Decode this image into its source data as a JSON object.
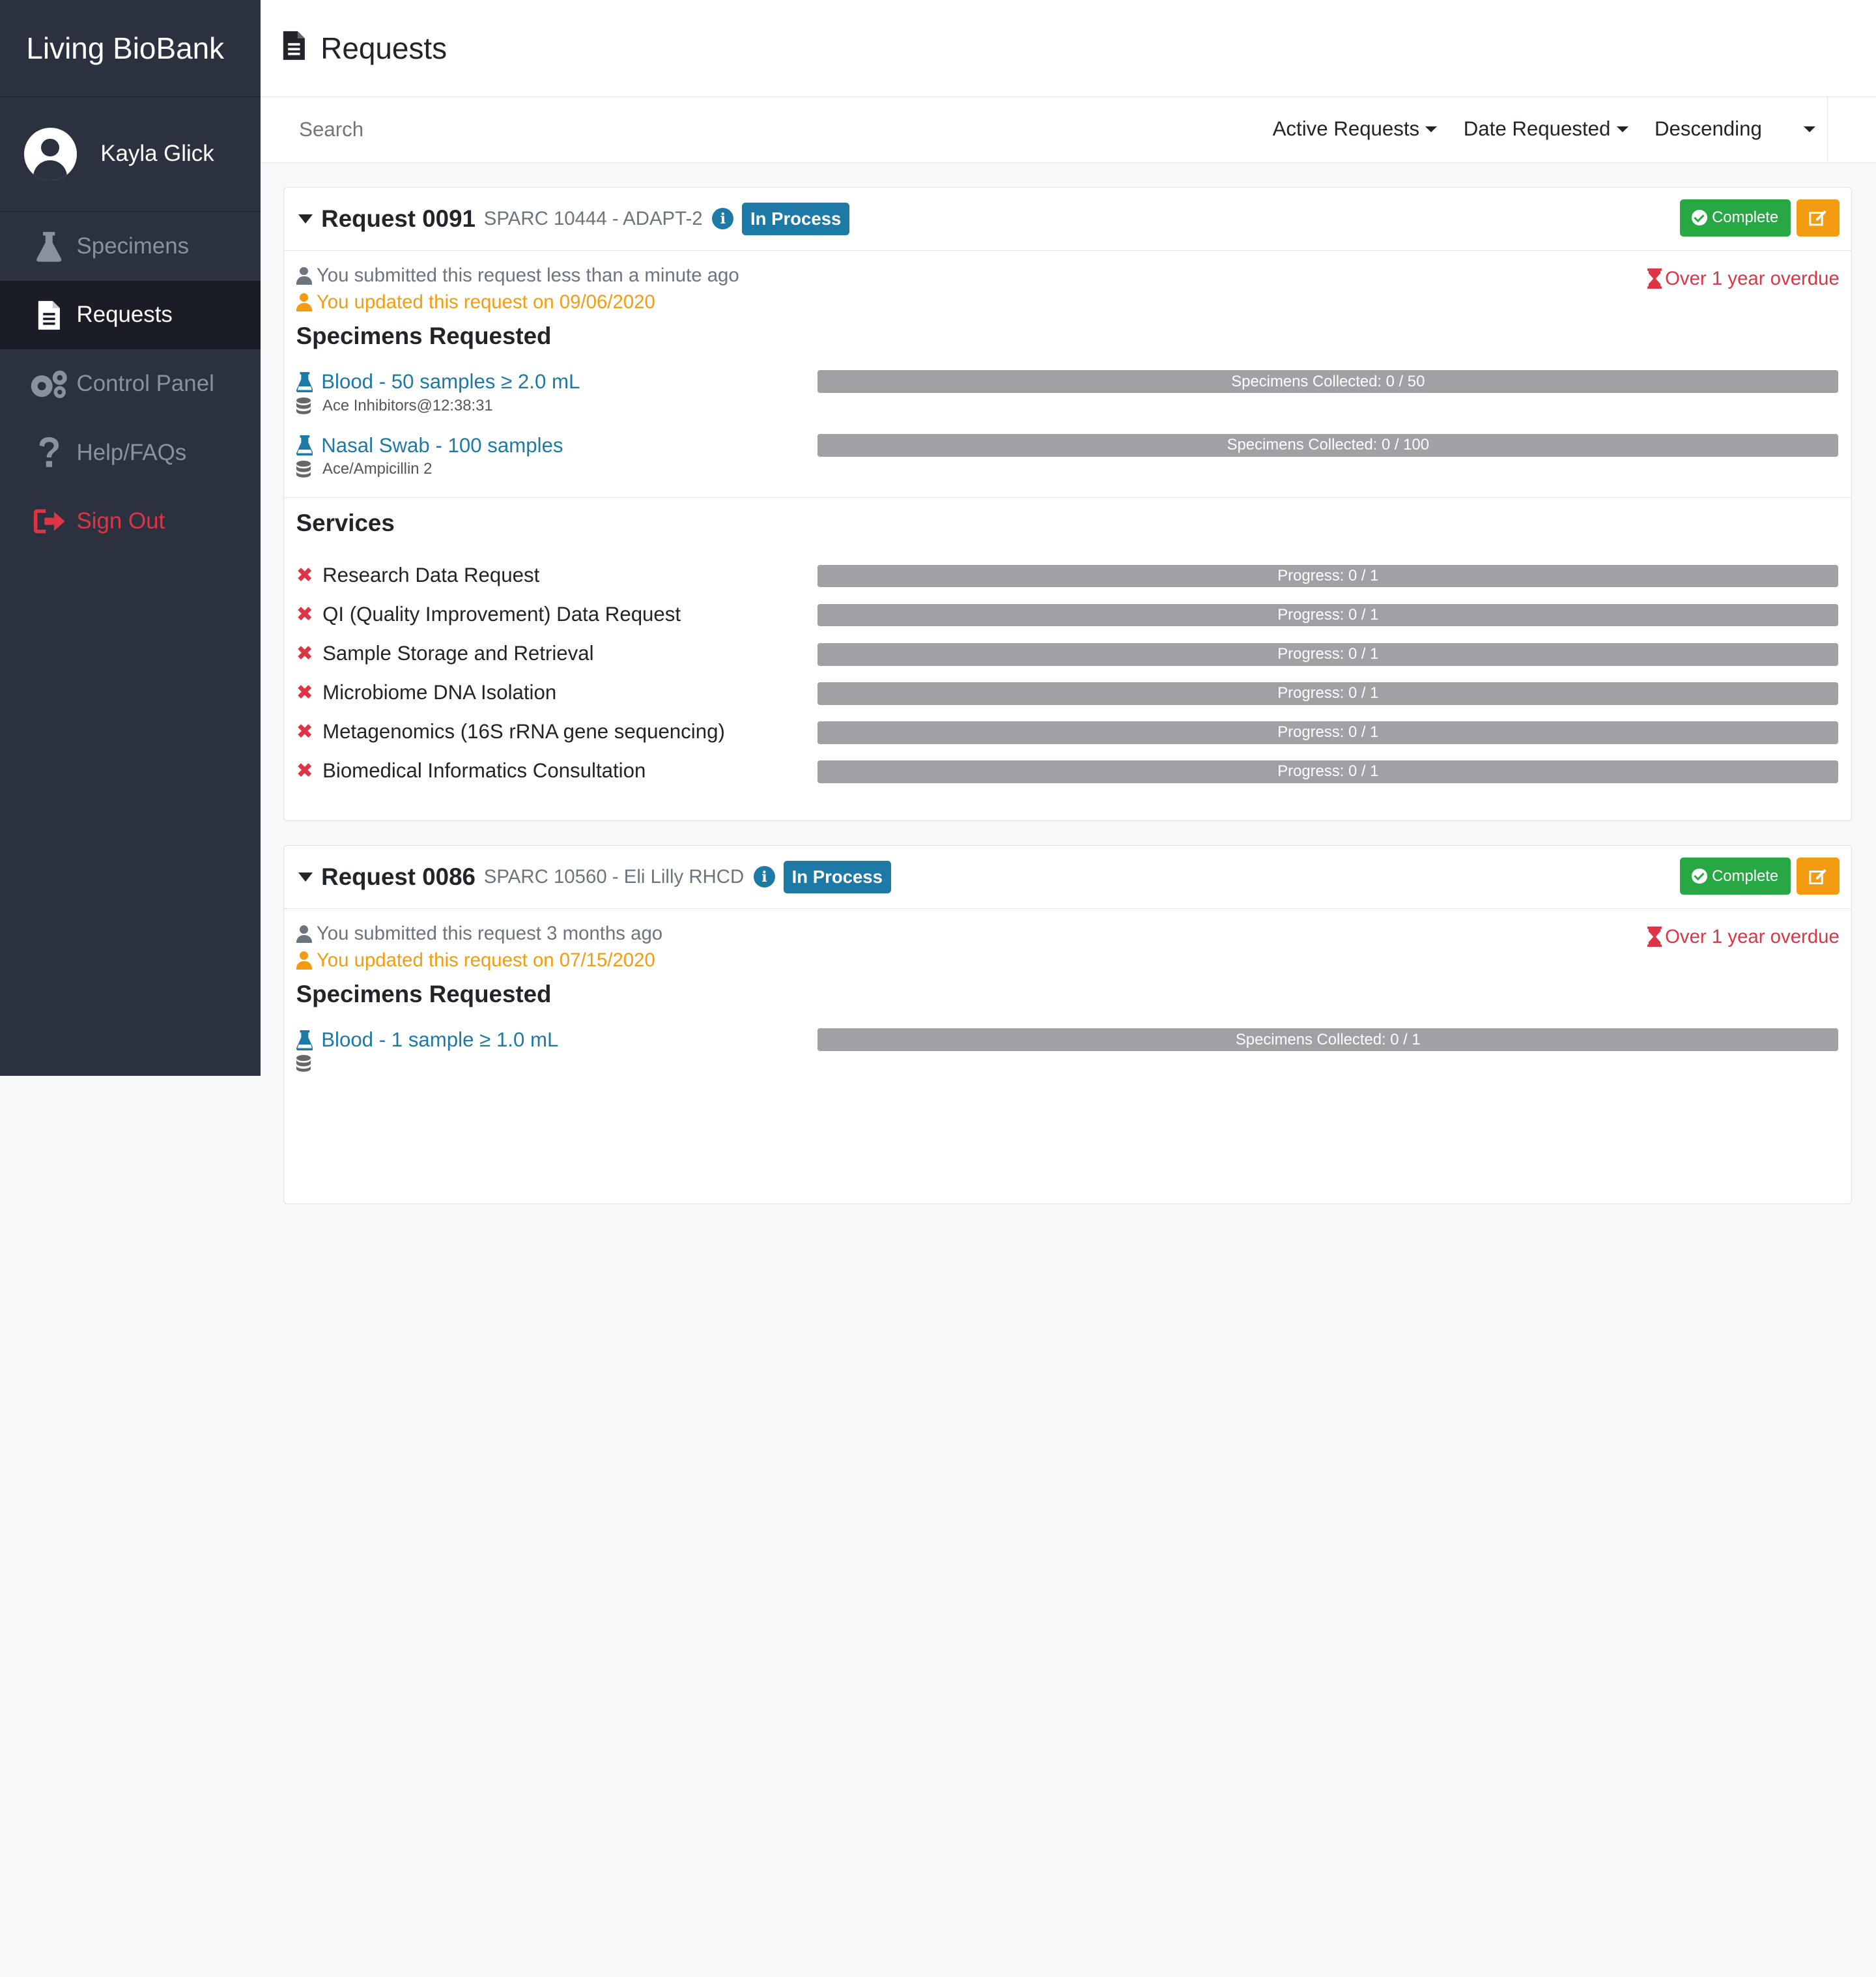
{
  "app": {
    "brand": "Living BioBank"
  },
  "user": {
    "name": "Kayla Glick"
  },
  "nav": {
    "items": [
      {
        "label": "Specimens",
        "icon": "flask-icon"
      },
      {
        "label": "Requests",
        "icon": "document-icon"
      },
      {
        "label": "Control Panel",
        "icon": "gears-icon"
      },
      {
        "label": "Help/FAQs",
        "icon": "question-icon"
      },
      {
        "label": "Sign Out",
        "icon": "sign-out-icon"
      }
    ],
    "active": "Requests"
  },
  "page": {
    "title": "Requests"
  },
  "filters": {
    "search_placeholder": "Search",
    "status": "Active Requests",
    "sort_by": "Date Requested",
    "order": "Descending"
  },
  "requests": [
    {
      "title": "Request 0091",
      "subtitle": "SPARC 10444 - ADAPT-2",
      "status": "In Process",
      "complete_label": "Complete",
      "submitted": "You submitted this request less than a minute ago",
      "updated": "You updated this request on 09/06/2020",
      "overdue": "Over 1 year overdue",
      "specimens_title": "Specimens Requested",
      "specimens": [
        {
          "name": "Blood - 50 samples ≥ 2.0 mL",
          "detail": "Ace Inhibitors@12:38:31",
          "progress": "Specimens Collected: 0 / 50",
          "collected": 0,
          "total": 50
        },
        {
          "name": "Nasal Swab - 100 samples",
          "detail": "Ace/Ampicillin 2",
          "progress": "Specimens Collected: 0 / 100",
          "collected": 0,
          "total": 100
        }
      ],
      "services_title": "Services",
      "services": [
        {
          "name": "Research Data Request",
          "progress": "Progress: 0 / 1"
        },
        {
          "name": "QI (Quality Improvement) Data Request",
          "progress": "Progress: 0 / 1"
        },
        {
          "name": "Sample Storage and Retrieval",
          "progress": "Progress: 0 / 1"
        },
        {
          "name": "Microbiome DNA Isolation",
          "progress": "Progress: 0 / 1"
        },
        {
          "name": "Metagenomics (16S rRNA gene sequencing)",
          "progress": "Progress: 0 / 1"
        },
        {
          "name": "Biomedical Informatics Consultation",
          "progress": "Progress: 0 / 1"
        }
      ]
    },
    {
      "title": "Request 0086",
      "subtitle": "SPARC 10560 - Eli Lilly RHCD",
      "status": "In Process",
      "complete_label": "Complete",
      "submitted": "You submitted this request 3 months ago",
      "updated": "You updated this request on 07/15/2020",
      "overdue": "Over 1 year overdue",
      "specimens_title": "Specimens Requested",
      "specimens": [
        {
          "name": "Blood - 1 sample ≥ 1.0 mL",
          "detail": "",
          "progress": "Specimens Collected: 0 / 1",
          "collected": 0,
          "total": 1
        }
      ]
    }
  ],
  "colors": {
    "sidebar": "#2c3140",
    "accent": "#1d7aa6",
    "success": "#28a745",
    "warning": "#f39c12",
    "danger": "#dc3545"
  }
}
